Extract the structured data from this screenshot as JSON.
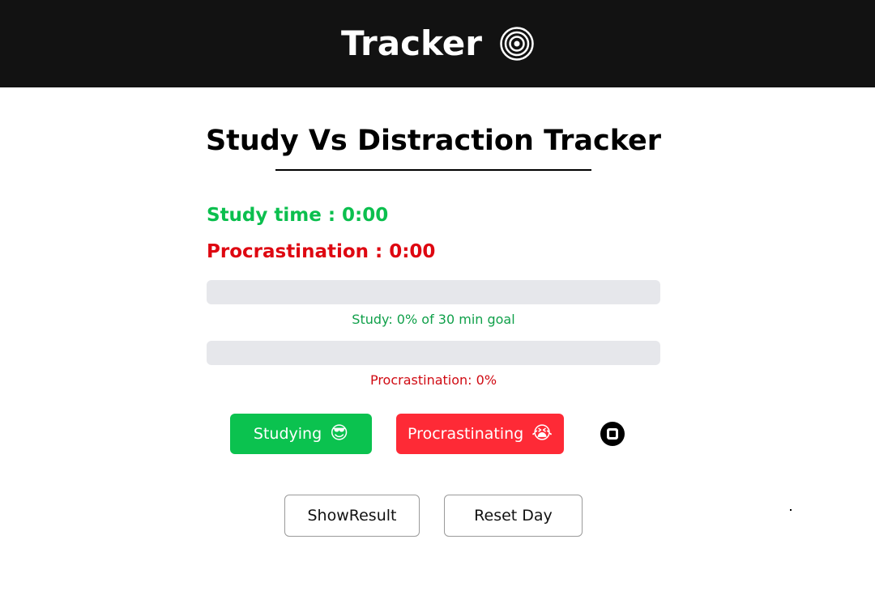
{
  "header": {
    "title": "Tracker",
    "icon": "target-icon"
  },
  "main": {
    "title": "Study Vs Distraction Tracker",
    "study_time": "Study time : 0:00",
    "procrastination_time": "Procrastination : 0:00",
    "study_progress": {
      "fraction": 0,
      "caption": "Study: 0% of 30 min goal"
    },
    "procrastination_progress": {
      "fraction": 0,
      "caption": "Procrastination: 0%"
    },
    "buttons": {
      "studying_label": "Studying",
      "studying_emoji": "😎",
      "procrastinating_label": "Procrastinating",
      "procrastinating_emoji": "😭",
      "stop_icon": "stop-icon",
      "show_result_label": "ShowResult",
      "reset_day_label": "Reset Day"
    }
  },
  "colors": {
    "header_bg": "#121212",
    "study_green": "#0bbf4e",
    "procrastination_red": "#de0711",
    "button_red": "#fe2a36",
    "track_gray": "#e6e7eb"
  }
}
